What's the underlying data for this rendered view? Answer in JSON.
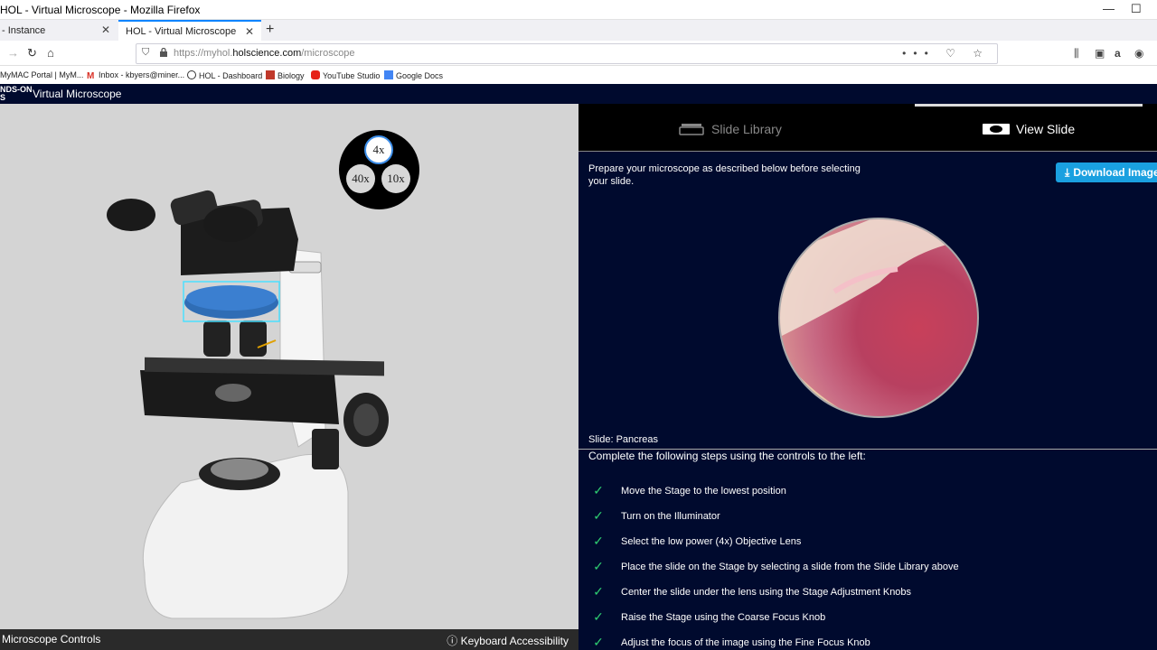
{
  "window": {
    "title": "HOL - Virtual Microscope - Mozilla Firefox"
  },
  "tabs": [
    {
      "label": "- Instance",
      "active": false
    },
    {
      "label": "HOL - Virtual Microscope",
      "active": true
    }
  ],
  "url": {
    "prefix": "https://myhol.",
    "domain": "holscience.com",
    "path": "/microscope"
  },
  "bookmarks": [
    {
      "label": "MyMAC Portal | MyM..."
    },
    {
      "label": "Inbox - kbyers@miner..."
    },
    {
      "label": "HOL - Dashboard"
    },
    {
      "label": "Biology"
    },
    {
      "label": "YouTube Studio"
    },
    {
      "label": "Google Docs"
    }
  ],
  "app": {
    "logo_line1": "NDS-ON",
    "logo_line2": "S",
    "name": "Virtual Microscope"
  },
  "objectives": {
    "low": "4x",
    "high": "40x",
    "mid": "10x"
  },
  "left_footer": {
    "controls": "Microscope Controls",
    "accessibility": "Keyboard Accessibility"
  },
  "right_tabs": {
    "library": "Slide Library",
    "view": "View Slide"
  },
  "prep_text": "Prepare your microscope as described below before selecting your slide.",
  "download_label": "Download Image",
  "slide_name": "Slide: Pancreas",
  "steps_heading": "Complete the following steps using the controls to the left:",
  "steps": [
    "Move the Stage to the lowest position",
    "Turn on the Illuminator",
    "Select the low power (4x) Objective Lens",
    "Place the slide on the Stage by selecting a slide from the Slide Library above",
    "Center the slide under the lens using the Stage Adjustment Knobs",
    "Raise the Stage using the Coarse Focus Knob",
    "Adjust the focus of the image using the Fine Focus Knob"
  ],
  "colors": {
    "app_bg": "#000a2e",
    "accent": "#1aa0e0",
    "check": "#2ecc71"
  }
}
